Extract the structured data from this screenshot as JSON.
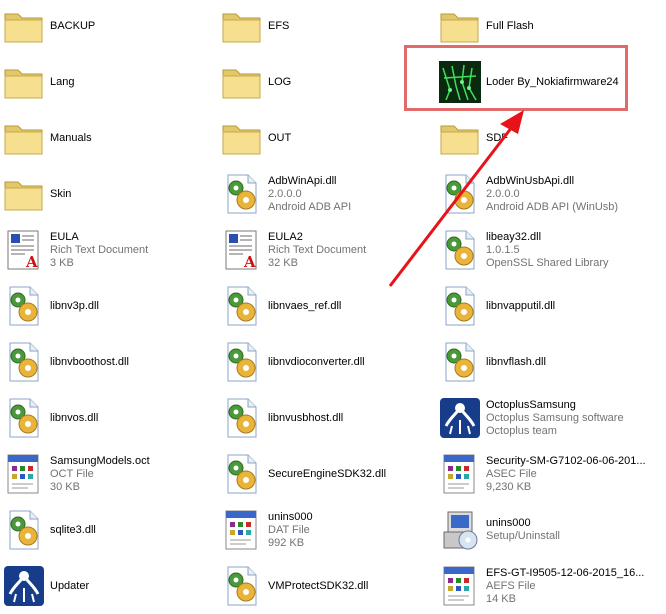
{
  "files": [
    {
      "name": "BACKUP",
      "icon": "folder-icon"
    },
    {
      "name": "EFS",
      "icon": "folder-icon"
    },
    {
      "name": "Full Flash",
      "icon": "folder-icon"
    },
    {
      "name": "Lang",
      "icon": "folder-icon"
    },
    {
      "name": "LOG",
      "icon": "folder-icon"
    },
    {
      "name": "Loder By_Nokiafirmware24",
      "icon": "loader-app-icon"
    },
    {
      "name": "Manuals",
      "icon": "folder-icon"
    },
    {
      "name": "OUT",
      "icon": "folder-icon"
    },
    {
      "name": "SDF",
      "icon": "folder-icon"
    },
    {
      "name": "Skin",
      "icon": "folder-icon"
    },
    {
      "name": "AdbWinApi.dll",
      "line2": "2.0.0.0",
      "line3": "Android ADB API",
      "icon": "dll-gear-icon"
    },
    {
      "name": "AdbWinUsbApi.dll",
      "line2": "2.0.0.0",
      "line3": "Android ADB API (WinUsb)",
      "icon": "dll-gear-icon"
    },
    {
      "name": "EULA",
      "line2": "Rich Text Document",
      "line3": "3 KB",
      "icon": "rich-text-document-icon"
    },
    {
      "name": "EULA2",
      "line2": "Rich Text Document",
      "line3": "32 KB",
      "icon": "rich-text-document-icon"
    },
    {
      "name": "libeay32.dll",
      "line2": "1.0.1.5",
      "line3": "OpenSSL Shared Library",
      "icon": "dll-gear-icon"
    },
    {
      "name": "libnv3p.dll",
      "icon": "dll-gear-icon"
    },
    {
      "name": "libnvaes_ref.dll",
      "icon": "dll-gear-icon"
    },
    {
      "name": "libnvapputil.dll",
      "icon": "dll-gear-icon"
    },
    {
      "name": "libnvboothost.dll",
      "icon": "dll-gear-icon"
    },
    {
      "name": "libnvdioconverter.dll",
      "icon": "dll-gear-icon"
    },
    {
      "name": "libnvflash.dll",
      "icon": "dll-gear-icon"
    },
    {
      "name": "libnvos.dll",
      "icon": "dll-gear-icon"
    },
    {
      "name": "libnvusbhost.dll",
      "icon": "dll-gear-icon"
    },
    {
      "name": "OctoplusSamsung",
      "line2": "Octoplus Samsung software",
      "line3": "Octoplus team",
      "icon": "octoplus-app-icon"
    },
    {
      "name": "SamsungModels.oct",
      "line2": "OCT File",
      "line3": "30 KB",
      "icon": "generic-file-icon"
    },
    {
      "name": "SecureEngineSDK32.dll",
      "icon": "dll-gear-icon"
    },
    {
      "name": "Security-SM-G7102-06-06-201...",
      "line2": "ASEC File",
      "line3": "9,230 KB",
      "icon": "generic-file-icon"
    },
    {
      "name": "sqlite3.dll",
      "icon": "dll-gear-icon"
    },
    {
      "name": "unins000",
      "line2": "DAT File",
      "line3": "992 KB",
      "icon": "generic-file-icon"
    },
    {
      "name": "unins000",
      "line2": "Setup/Uninstall",
      "icon": "setup-installer-icon"
    },
    {
      "name": "Updater",
      "icon": "octoplus-app-icon"
    },
    {
      "name": "VMProtectSDK32.dll",
      "icon": "dll-gear-icon"
    },
    {
      "name": "EFS-GT-I9505-12-06-2015_16...",
      "line2": "AEFS File",
      "line3": "14 KB",
      "icon": "generic-file-icon"
    }
  ]
}
